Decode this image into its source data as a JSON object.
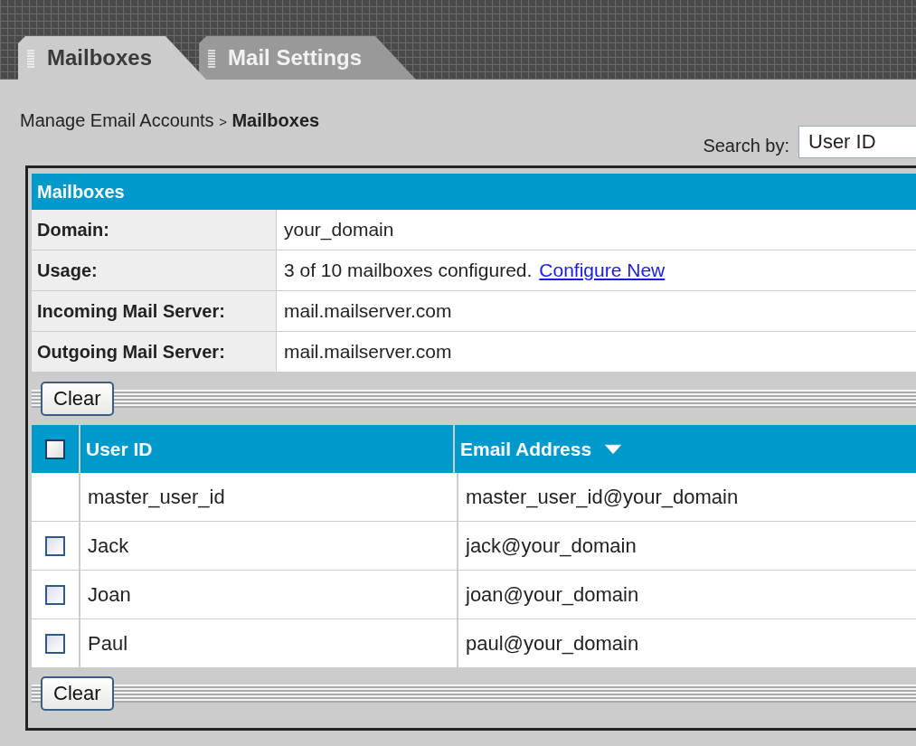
{
  "tabs": [
    {
      "label": "Mailboxes",
      "selected": true
    },
    {
      "label": "Mail Settings",
      "selected": false
    }
  ],
  "breadcrumb": {
    "parent": "Manage Email Accounts",
    "separator": ">",
    "current": "Mailboxes"
  },
  "search": {
    "label": "Search by:",
    "value": "User ID"
  },
  "panel": {
    "title": "Mailboxes",
    "info": [
      {
        "label": "Domain:",
        "value": "your_domain"
      },
      {
        "label": "Usage:",
        "value": "3 of 10 mailboxes configured.",
        "link": "Configure New"
      },
      {
        "label": "Incoming Mail Server:",
        "value": "mail.mailserver.com"
      },
      {
        "label": "Outgoing Mail Server:",
        "value": "mail.mailserver.com"
      }
    ],
    "clear_button": "Clear",
    "table": {
      "select_all": {
        "checked": false
      },
      "columns": [
        {
          "label": "User ID",
          "sorted": false
        },
        {
          "label": "Email Address",
          "sorted": true
        }
      ],
      "rows": [
        {
          "kind": "fixed",
          "user_id": "master_user_id",
          "email": "master_user_id@your_domain"
        },
        {
          "kind": "user",
          "checked": false,
          "user_id": "Jack",
          "email": "jack@your_domain"
        },
        {
          "kind": "user",
          "checked": false,
          "user_id": "Joan",
          "email": "joan@your_domain"
        },
        {
          "kind": "user",
          "checked": false,
          "user_id": "Paul",
          "email": "paul@your_domain"
        }
      ]
    },
    "bottom_clear_button": "Clear"
  }
}
